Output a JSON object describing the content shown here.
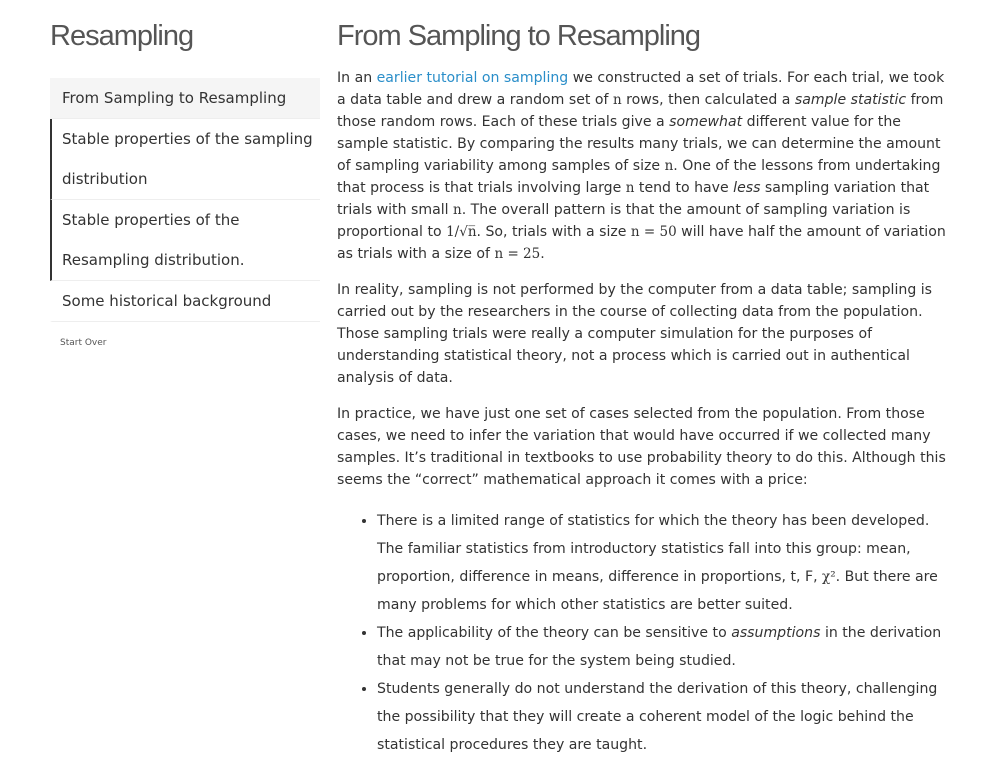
{
  "sidebar": {
    "title": "Resampling",
    "items": [
      {
        "label": "From Sampling to Resampling"
      },
      {
        "label": "Stable properties of the sampling distribution"
      },
      {
        "label": "Stable properties of the Resampling distribution."
      },
      {
        "label": "Some historical background"
      }
    ],
    "start_over": "Start Over"
  },
  "main": {
    "title": "From Sampling to Resampling",
    "p1": {
      "t1": "In an ",
      "link": "earlier tutorial on sampling",
      "t2": " we constructed a set of trials. For each trial, we took a data table and drew a random set of ",
      "n1": "n",
      "t3": " rows, then calculated a ",
      "em1": "sample statistic",
      "t4": " from those random rows. Each of these trials give a ",
      "em2": "somewhat",
      "t5": " different value for the sample statistic. By comparing the results many trials, we can determine the amount of sampling variability among samples of size ",
      "n2": "n",
      "t6": ". One of the lessons from undertaking that process is that trials involving large ",
      "n3": "n",
      "t7": " tend to have ",
      "em3": "less",
      "t8": " sampling variation that trials with small ",
      "n4": "n",
      "t9": ". The overall pattern is that the amount of sampling variation is proportional to ",
      "m1": "1/√n̅",
      "t10": ". So, trials with a size ",
      "m2": "n = 50",
      "t11": " will have half the amount of variation as trials with a size of ",
      "m3": "n = 25",
      "t12": "."
    },
    "p2": "In reality, sampling is not performed by the computer from a data table; sampling is carried out by the researchers in the course of collecting data from the population. Those sampling trials were really a computer simulation for the purposes of understanding statistical theory, not a process which is carried out in authentical analysis of data.",
    "p3": "In practice, we have just one set of cases selected from the population. From those cases, we need to infer the variation that would have occurred if we collected many samples. It’s traditional in textbooks to use probability theory to do this. Although this seems the “correct” mathematical approach it comes with a price:",
    "bullets": {
      "b1a": "There is a limited range of statistics for which the theory has been developed. The familiar statistics from introductory statistics fall into this group: mean, proportion, difference in means, difference in proportions, t, F, ",
      "b1m": "χ²",
      "b1b": ". But there are many problems for which other statistics are better suited.",
      "b2a": "The applicability of the theory can be sensitive to ",
      "b2em": "assumptions",
      "b2b": " in the derivation that may not be true for the system being studied.",
      "b3": "Students generally do not understand the derivation of this theory, challenging the possibility that they will create a coherent model of the logic behind the statistical procedures they are taught."
    }
  }
}
